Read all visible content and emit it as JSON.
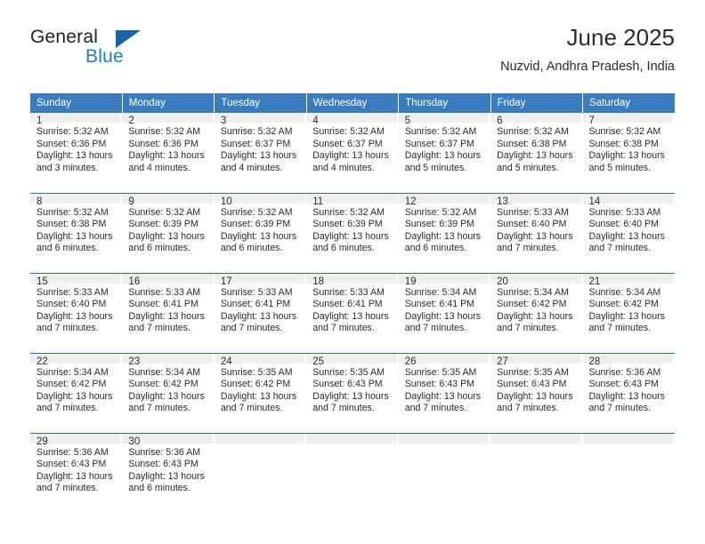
{
  "logo": {
    "word1": "General",
    "word2": "Blue",
    "triangle_color": "#1565a8",
    "blue_color": "#1f7fc4"
  },
  "header": {
    "title": "June 2025",
    "location": "Nuzvid, Andhra Pradesh, India"
  },
  "theme": {
    "header_bg": "#3a7dbf",
    "daynum_bg": "#efefef",
    "row_divider": "#2c6fae",
    "text": "#2b2b2b"
  },
  "weekdays": [
    "Sunday",
    "Monday",
    "Tuesday",
    "Wednesday",
    "Thursday",
    "Friday",
    "Saturday"
  ],
  "weeks": [
    [
      {
        "day": "1",
        "sunrise": "Sunrise: 5:32 AM",
        "sunset": "Sunset: 6:36 PM",
        "daylight": "Daylight: 13 hours and 3 minutes."
      },
      {
        "day": "2",
        "sunrise": "Sunrise: 5:32 AM",
        "sunset": "Sunset: 6:36 PM",
        "daylight": "Daylight: 13 hours and 4 minutes."
      },
      {
        "day": "3",
        "sunrise": "Sunrise: 5:32 AM",
        "sunset": "Sunset: 6:37 PM",
        "daylight": "Daylight: 13 hours and 4 minutes."
      },
      {
        "day": "4",
        "sunrise": "Sunrise: 5:32 AM",
        "sunset": "Sunset: 6:37 PM",
        "daylight": "Daylight: 13 hours and 4 minutes."
      },
      {
        "day": "5",
        "sunrise": "Sunrise: 5:32 AM",
        "sunset": "Sunset: 6:37 PM",
        "daylight": "Daylight: 13 hours and 5 minutes."
      },
      {
        "day": "6",
        "sunrise": "Sunrise: 5:32 AM",
        "sunset": "Sunset: 6:38 PM",
        "daylight": "Daylight: 13 hours and 5 minutes."
      },
      {
        "day": "7",
        "sunrise": "Sunrise: 5:32 AM",
        "sunset": "Sunset: 6:38 PM",
        "daylight": "Daylight: 13 hours and 5 minutes."
      }
    ],
    [
      {
        "day": "8",
        "sunrise": "Sunrise: 5:32 AM",
        "sunset": "Sunset: 6:38 PM",
        "daylight": "Daylight: 13 hours and 6 minutes."
      },
      {
        "day": "9",
        "sunrise": "Sunrise: 5:32 AM",
        "sunset": "Sunset: 6:39 PM",
        "daylight": "Daylight: 13 hours and 6 minutes."
      },
      {
        "day": "10",
        "sunrise": "Sunrise: 5:32 AM",
        "sunset": "Sunset: 6:39 PM",
        "daylight": "Daylight: 13 hours and 6 minutes."
      },
      {
        "day": "11",
        "sunrise": "Sunrise: 5:32 AM",
        "sunset": "Sunset: 6:39 PM",
        "daylight": "Daylight: 13 hours and 6 minutes."
      },
      {
        "day": "12",
        "sunrise": "Sunrise: 5:32 AM",
        "sunset": "Sunset: 6:39 PM",
        "daylight": "Daylight: 13 hours and 6 minutes."
      },
      {
        "day": "13",
        "sunrise": "Sunrise: 5:33 AM",
        "sunset": "Sunset: 6:40 PM",
        "daylight": "Daylight: 13 hours and 7 minutes."
      },
      {
        "day": "14",
        "sunrise": "Sunrise: 5:33 AM",
        "sunset": "Sunset: 6:40 PM",
        "daylight": "Daylight: 13 hours and 7 minutes."
      }
    ],
    [
      {
        "day": "15",
        "sunrise": "Sunrise: 5:33 AM",
        "sunset": "Sunset: 6:40 PM",
        "daylight": "Daylight: 13 hours and 7 minutes."
      },
      {
        "day": "16",
        "sunrise": "Sunrise: 5:33 AM",
        "sunset": "Sunset: 6:41 PM",
        "daylight": "Daylight: 13 hours and 7 minutes."
      },
      {
        "day": "17",
        "sunrise": "Sunrise: 5:33 AM",
        "sunset": "Sunset: 6:41 PM",
        "daylight": "Daylight: 13 hours and 7 minutes."
      },
      {
        "day": "18",
        "sunrise": "Sunrise: 5:33 AM",
        "sunset": "Sunset: 6:41 PM",
        "daylight": "Daylight: 13 hours and 7 minutes."
      },
      {
        "day": "19",
        "sunrise": "Sunrise: 5:34 AM",
        "sunset": "Sunset: 6:41 PM",
        "daylight": "Daylight: 13 hours and 7 minutes."
      },
      {
        "day": "20",
        "sunrise": "Sunrise: 5:34 AM",
        "sunset": "Sunset: 6:42 PM",
        "daylight": "Daylight: 13 hours and 7 minutes."
      },
      {
        "day": "21",
        "sunrise": "Sunrise: 5:34 AM",
        "sunset": "Sunset: 6:42 PM",
        "daylight": "Daylight: 13 hours and 7 minutes."
      }
    ],
    [
      {
        "day": "22",
        "sunrise": "Sunrise: 5:34 AM",
        "sunset": "Sunset: 6:42 PM",
        "daylight": "Daylight: 13 hours and 7 minutes."
      },
      {
        "day": "23",
        "sunrise": "Sunrise: 5:34 AM",
        "sunset": "Sunset: 6:42 PM",
        "daylight": "Daylight: 13 hours and 7 minutes."
      },
      {
        "day": "24",
        "sunrise": "Sunrise: 5:35 AM",
        "sunset": "Sunset: 6:42 PM",
        "daylight": "Daylight: 13 hours and 7 minutes."
      },
      {
        "day": "25",
        "sunrise": "Sunrise: 5:35 AM",
        "sunset": "Sunset: 6:43 PM",
        "daylight": "Daylight: 13 hours and 7 minutes."
      },
      {
        "day": "26",
        "sunrise": "Sunrise: 5:35 AM",
        "sunset": "Sunset: 6:43 PM",
        "daylight": "Daylight: 13 hours and 7 minutes."
      },
      {
        "day": "27",
        "sunrise": "Sunrise: 5:35 AM",
        "sunset": "Sunset: 6:43 PM",
        "daylight": "Daylight: 13 hours and 7 minutes."
      },
      {
        "day": "28",
        "sunrise": "Sunrise: 5:36 AM",
        "sunset": "Sunset: 6:43 PM",
        "daylight": "Daylight: 13 hours and 7 minutes."
      }
    ],
    [
      {
        "day": "29",
        "sunrise": "Sunrise: 5:36 AM",
        "sunset": "Sunset: 6:43 PM",
        "daylight": "Daylight: 13 hours and 7 minutes."
      },
      {
        "day": "30",
        "sunrise": "Sunrise: 5:36 AM",
        "sunset": "Sunset: 6:43 PM",
        "daylight": "Daylight: 13 hours and 6 minutes."
      },
      {
        "day": "",
        "sunrise": "",
        "sunset": "",
        "daylight": ""
      },
      {
        "day": "",
        "sunrise": "",
        "sunset": "",
        "daylight": ""
      },
      {
        "day": "",
        "sunrise": "",
        "sunset": "",
        "daylight": ""
      },
      {
        "day": "",
        "sunrise": "",
        "sunset": "",
        "daylight": ""
      },
      {
        "day": "",
        "sunrise": "",
        "sunset": "",
        "daylight": ""
      }
    ]
  ]
}
